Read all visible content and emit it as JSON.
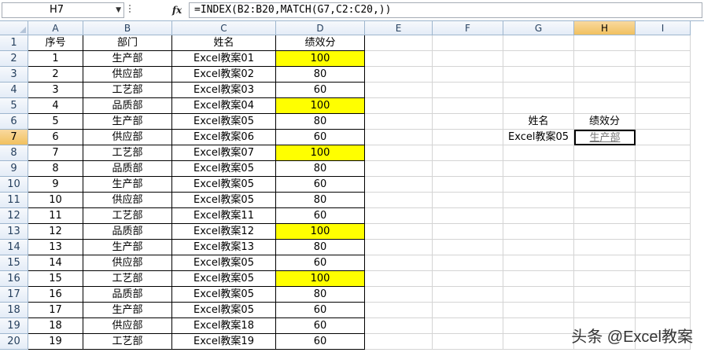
{
  "formula_bar": {
    "name_box": "H7",
    "fx_label": "fx",
    "formula": "=INDEX(B2:B20,MATCH(G7,C2:C20,))"
  },
  "sheet": {
    "columns": [
      "A",
      "B",
      "C",
      "D",
      "E",
      "F",
      "G",
      "H",
      "I"
    ],
    "selected_column": "H",
    "selected_row": 7,
    "row_numbers": [
      1,
      2,
      3,
      4,
      5,
      6,
      7,
      8,
      9,
      10,
      11,
      12,
      13,
      14,
      15,
      16,
      17,
      18,
      19,
      20
    ],
    "table_headers": [
      "序号",
      "部门",
      "姓名",
      "绩效分"
    ],
    "rows": [
      [
        "1",
        "生产部",
        "Excel教案01",
        "100"
      ],
      [
        "2",
        "供应部",
        "Excel教案02",
        "80"
      ],
      [
        "3",
        "工艺部",
        "Excel教案03",
        "60"
      ],
      [
        "4",
        "品质部",
        "Excel教案04",
        "100"
      ],
      [
        "5",
        "生产部",
        "Excel教案05",
        "80"
      ],
      [
        "6",
        "供应部",
        "Excel教案06",
        "60"
      ],
      [
        "7",
        "工艺部",
        "Excel教案07",
        "100"
      ],
      [
        "8",
        "品质部",
        "Excel教案05",
        "80"
      ],
      [
        "9",
        "生产部",
        "Excel教案05",
        "60"
      ],
      [
        "10",
        "供应部",
        "Excel教案05",
        "80"
      ],
      [
        "11",
        "工艺部",
        "Excel教案11",
        "60"
      ],
      [
        "12",
        "品质部",
        "Excel教案12",
        "100"
      ],
      [
        "13",
        "生产部",
        "Excel教案13",
        "80"
      ],
      [
        "14",
        "供应部",
        "Excel教案05",
        "60"
      ],
      [
        "15",
        "工艺部",
        "Excel教案05",
        "100"
      ],
      [
        "16",
        "品质部",
        "Excel教案05",
        "80"
      ],
      [
        "17",
        "生产部",
        "Excel教案05",
        "60"
      ],
      [
        "18",
        "供应部",
        "Excel教案18",
        "60"
      ],
      [
        "19",
        "工艺部",
        "Excel教案19",
        "60"
      ]
    ],
    "lookup": {
      "label_name": "姓名",
      "label_score": "绩效分",
      "lookup_value": "Excel教案05",
      "result": "生产部"
    },
    "highlight_color": "#ffff00"
  },
  "watermark": "头条 @Excel教案"
}
